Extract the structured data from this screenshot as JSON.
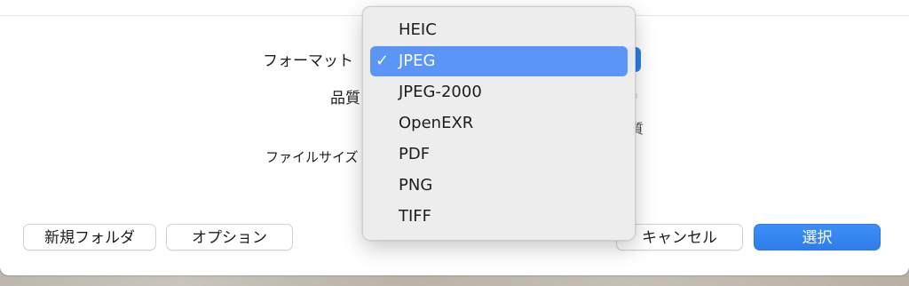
{
  "form": {
    "format_label": "フォーマット",
    "quality_label": "品質",
    "filesize_label": "ファイルサイズ",
    "quality_end_glyph": "質"
  },
  "buttons": {
    "new_folder": "新規フォルダ",
    "options": "オプション",
    "cancel": "キャンセル",
    "choose": "選択"
  },
  "format_menu": {
    "check_glyph": "✓",
    "selected": "JPEG",
    "items": [
      "HEIC",
      "JPEG",
      "JPEG-2000",
      "OpenEXR",
      "PDF",
      "PNG",
      "TIFF"
    ]
  },
  "colors": {
    "accent": "#2f7de8",
    "menu_highlight": "#5b96f7"
  }
}
